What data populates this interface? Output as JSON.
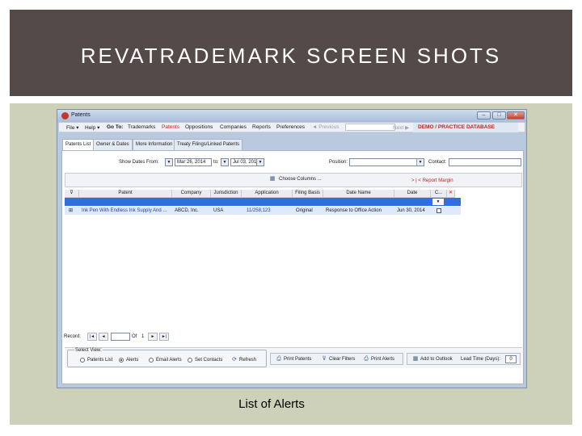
{
  "slide": {
    "title": "REVATRADEMARK SCREEN SHOTS",
    "caption": "List of Alerts"
  },
  "window": {
    "title": "Patents",
    "controls": {
      "minimize": "–",
      "maximize": "□",
      "close": "✕"
    }
  },
  "menu": {
    "file": "File ▾",
    "help": "Help ▾",
    "goto": "Go To:",
    "trademarks": "Trademarks",
    "patents": "Patents",
    "oppositions": "Oppositions",
    "companies": "Companies",
    "reports": "Reports",
    "preferences": "Preferences",
    "previous": "◄ Previous",
    "next": "Next ▶",
    "demo": "DEMO / PRACTICE DATABASE"
  },
  "tabs": [
    "Patents List",
    "Owner & Dates",
    "More Information",
    "Treaty Filings/Linked Patents"
  ],
  "filters": {
    "show_dates_from": "Show Dates From:",
    "from_date": "Mar 26, 2014",
    "to_label": "to:",
    "to_date": "Jul 03, 2014",
    "position_label": "Position:",
    "contact_label": "Contact:"
  },
  "choose_columns": "Choose Columns ...",
  "report_margin": "> | < Report Margin",
  "grid": {
    "columns": [
      "Patent",
      "Company",
      "Jurisdiction",
      "Application",
      "Filing Basis",
      "Date Name",
      "Date",
      "C..."
    ],
    "rows": [
      {
        "patent": "Ink Pen With Endless Ink Supply And ...",
        "company": "ABCD, Inc.",
        "jurisdiction": "USA",
        "application": "11/258,123",
        "filing_basis": "Original",
        "date_name": "Response to Office Action",
        "date": "Jun 30, 2014"
      }
    ]
  },
  "record": {
    "label": "Record:",
    "of": "Of",
    "total": "1"
  },
  "select_view": {
    "label": "Select View:",
    "options": [
      "Patents List",
      "Alerts",
      "Email Alerts",
      "Set Contacts"
    ],
    "selected": "Alerts",
    "refresh": "Refresh"
  },
  "actions": {
    "print_patents": "Print Patents",
    "clear_filters": "Clear Filters",
    "print_alerts": "Print Alerts",
    "add_to_outlook": "Add to Outlook",
    "lead_time_label": "Lead Time (Days):",
    "lead_time_value": "0"
  }
}
